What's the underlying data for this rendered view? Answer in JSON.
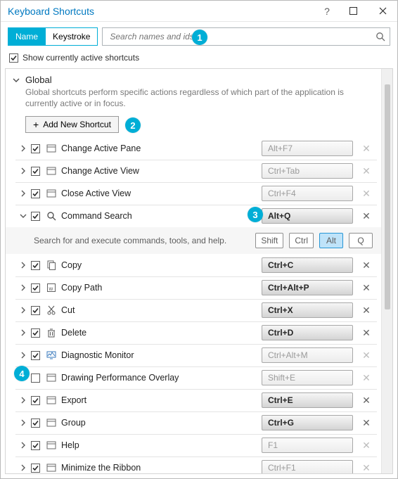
{
  "window": {
    "title": "Keyboard Shortcuts"
  },
  "filter": {
    "tabs": {
      "name": "Name",
      "keystroke": "Keystroke"
    },
    "search_placeholder": "Search names and ids"
  },
  "options": {
    "show_active_label": "Show currently active shortcuts"
  },
  "section": {
    "title": "Global",
    "description": "Global shortcuts perform specific actions regardless of which part of the application is currently active or in focus.",
    "add_button": "Add New Shortcut"
  },
  "detail": {
    "hint": "Search for and execute commands, tools, and help.",
    "keys": {
      "shift": "Shift",
      "ctrl": "Ctrl",
      "alt": "Alt",
      "q": "Q"
    }
  },
  "shortcuts": [
    {
      "name": "Change Active Pane",
      "kbd": "Alt+F7",
      "assigned": false,
      "checked": true,
      "expanded": false,
      "deleteEnabled": false,
      "icon": "window"
    },
    {
      "name": "Change Active View",
      "kbd": "Ctrl+Tab",
      "assigned": false,
      "checked": true,
      "expanded": false,
      "deleteEnabled": false,
      "icon": "window"
    },
    {
      "name": "Close Active View",
      "kbd": "Ctrl+F4",
      "assigned": false,
      "checked": true,
      "expanded": false,
      "deleteEnabled": false,
      "icon": "window"
    },
    {
      "name": "Command Search",
      "kbd": "Alt+Q",
      "assigned": true,
      "checked": true,
      "expanded": true,
      "deleteEnabled": true,
      "icon": "search"
    },
    {
      "name": "Copy",
      "kbd": "Ctrl+C",
      "assigned": true,
      "checked": true,
      "expanded": false,
      "deleteEnabled": true,
      "icon": "copy"
    },
    {
      "name": "Copy Path",
      "kbd": "Ctrl+Alt+P",
      "assigned": true,
      "checked": true,
      "expanded": false,
      "deleteEnabled": true,
      "icon": "copypath"
    },
    {
      "name": "Cut",
      "kbd": "Ctrl+X",
      "assigned": true,
      "checked": true,
      "expanded": false,
      "deleteEnabled": true,
      "icon": "cut"
    },
    {
      "name": "Delete",
      "kbd": "Ctrl+D",
      "assigned": true,
      "checked": true,
      "expanded": false,
      "deleteEnabled": true,
      "icon": "trash"
    },
    {
      "name": "Diagnostic Monitor",
      "kbd": "Ctrl+Alt+M",
      "assigned": false,
      "checked": true,
      "expanded": false,
      "deleteEnabled": false,
      "icon": "monitor"
    },
    {
      "name": "Drawing Performance Overlay",
      "kbd": "Shift+E",
      "assigned": false,
      "checked": false,
      "expanded": false,
      "deleteEnabled": false,
      "icon": "window"
    },
    {
      "name": "Export",
      "kbd": "Ctrl+E",
      "assigned": true,
      "checked": true,
      "expanded": false,
      "deleteEnabled": true,
      "icon": "window"
    },
    {
      "name": "Group",
      "kbd": "Ctrl+G",
      "assigned": true,
      "checked": true,
      "expanded": false,
      "deleteEnabled": true,
      "icon": "window"
    },
    {
      "name": "Help",
      "kbd": "F1",
      "assigned": false,
      "checked": true,
      "expanded": false,
      "deleteEnabled": false,
      "icon": "window"
    },
    {
      "name": "Minimize the Ribbon",
      "kbd": "Ctrl+F1",
      "assigned": false,
      "checked": true,
      "expanded": false,
      "deleteEnabled": false,
      "icon": "window"
    }
  ],
  "callouts": {
    "c1": "1",
    "c2": "2",
    "c3": "3",
    "c4": "4"
  }
}
